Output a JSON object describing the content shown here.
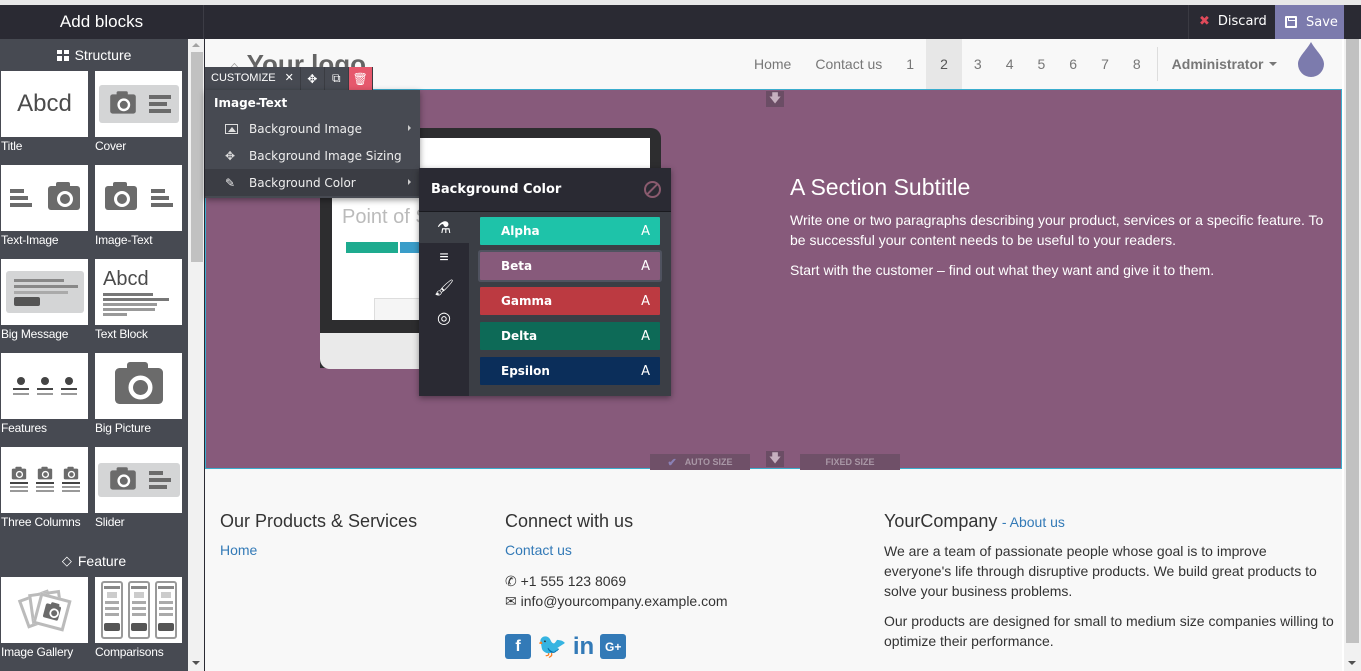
{
  "topbar": {
    "panel_title": "Add blocks",
    "discard_label": "Discard",
    "save_label": "Save",
    "save_color": "#7c7bad",
    "discard_icon_color": "#e04a5a"
  },
  "sidebar": {
    "sections": [
      {
        "title": "Structure",
        "icon": "th-large-icon",
        "blocks": [
          {
            "label": "Title"
          },
          {
            "label": "Cover"
          },
          {
            "label": "Text-Image"
          },
          {
            "label": "Image-Text"
          },
          {
            "label": "Big Message"
          },
          {
            "label": "Text Block"
          },
          {
            "label": "Features"
          },
          {
            "label": "Big Picture"
          },
          {
            "label": "Three Columns"
          },
          {
            "label": "Slider"
          }
        ]
      },
      {
        "title": "Feature",
        "icon": "diamond-icon",
        "blocks": [
          {
            "label": "Image Gallery"
          },
          {
            "label": "Comparisons"
          }
        ]
      }
    ],
    "thumb_text": "Abcd"
  },
  "navbar": {
    "logo_text": "Your logo",
    "links": [
      "Home",
      "Contact us",
      "1",
      "2",
      "3",
      "4",
      "5",
      "6",
      "7",
      "8"
    ],
    "active_link": "2",
    "user_menu": "Administrator"
  },
  "customize": {
    "label": "CUSTOMIZE",
    "menu_title": "Image-Text",
    "items": [
      {
        "label": "Background Image",
        "icon": "picture-icon",
        "submenu": true
      },
      {
        "label": "Background Image Sizing",
        "icon": "arrows-icon",
        "submenu": false
      },
      {
        "label": "Background Color",
        "icon": "eyedropper-icon",
        "submenu": true,
        "active": true
      }
    ]
  },
  "bg_color_panel": {
    "title": "Background Color",
    "tabs": [
      "flask-icon",
      "database-icon",
      "paint-brush-icon",
      "eye-slash-icon"
    ],
    "swatches": [
      {
        "name": "Alpha",
        "letter": "A",
        "color": "#1ec3a9"
      },
      {
        "name": "Beta",
        "letter": "A",
        "color": "#875a7b",
        "selected": true
      },
      {
        "name": "Gamma",
        "letter": "A",
        "color": "#bc3a41"
      },
      {
        "name": "Delta",
        "letter": "A",
        "color": "#0d6a57"
      },
      {
        "name": "Epsilon",
        "letter": "A",
        "color": "#0b2e5a"
      }
    ]
  },
  "hero": {
    "background": "#875a7b",
    "subtitle": "A Section Subtitle",
    "paragraph1": "Write one or two paragraphs describing your product, services or a specific feature. To be successful your content needs to be useful to your readers.",
    "paragraph2": "Start with the customer – find out what they want and give it to them.",
    "auto_size_label": "AUTO SIZE",
    "fixed_size_label": "FIXED SIZE"
  },
  "footer": {
    "col1": {
      "title": "Our Products & Services",
      "links": [
        "Home"
      ]
    },
    "col2": {
      "title": "Connect with us",
      "link": "Contact us",
      "phone": "+1 555 123 8069",
      "email": "info@yourcompany.example.com",
      "social": [
        "facebook",
        "twitter",
        "linkedin",
        "google-plus"
      ]
    },
    "col3": {
      "title": "YourCompany",
      "about_link": "- About us",
      "p1": "We are a team of passionate people whose goal is to improve everyone's life through disruptive products. We build great products to solve your business problems.",
      "p2": "Our products are designed for small to medium size companies willing to optimize their performance."
    }
  }
}
